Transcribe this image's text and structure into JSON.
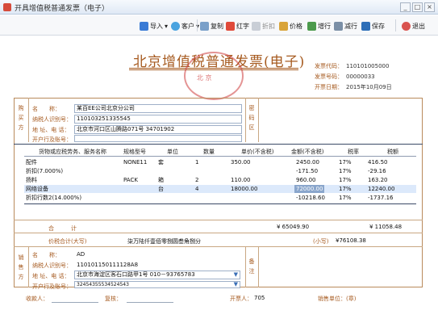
{
  "window": {
    "title": "开具增值税普通发票（电子）",
    "min": "_",
    "max": "□",
    "close": "×"
  },
  "toolbar": {
    "import": "导入",
    "customer": "客户",
    "copy": "复制",
    "red": "红字",
    "discount": "折扣",
    "price": "价格",
    "add_row": "增行",
    "del_row": "减行",
    "save": "保存",
    "exit": "退出"
  },
  "invoice": {
    "title": "北京增值税普通发票(电子)",
    "seal_text": "北 京",
    "code_label": "发票代码：",
    "code": "110101005000",
    "number_label": "发票号码：",
    "number": "00000033",
    "date_label": "开票日期：",
    "date": "2015年10月09日"
  },
  "buyer": {
    "section": "购买方",
    "name_label": "名　　称：",
    "name": "某百EE公司北京分公司",
    "tax_label": "纳税人识别号：",
    "tax_id": "110103251335545",
    "addr_label": "地 址、电 话：",
    "addr": "北京市河口区山腾路071号 34701902",
    "bank_label": "开户行及账号：",
    "bank": ""
  },
  "password_area": "密码区",
  "table": {
    "headers": [
      "货物或应税劳务、服务名称",
      "规格型号",
      "单位",
      "数量",
      "单价(不含税)",
      "金额(不含税)",
      "税率",
      "税额"
    ],
    "rows": [
      [
        "配件",
        "NONE11",
        "套",
        "1",
        "350.00",
        "2450.00",
        "17%",
        "416.50"
      ],
      [
        "折扣(7.000%)",
        "",
        "",
        "",
        "",
        "-171.50",
        "17%",
        "-29.16"
      ],
      [
        "扬料",
        "PACK",
        "箱",
        "2",
        "110.00",
        "960.00",
        "17%",
        "163.20"
      ],
      [
        "网络设备",
        "",
        "台",
        "4",
        "18000.00",
        "72000.00",
        "17%",
        "12240.00"
      ],
      [
        "折扣行数2(14.000%)",
        "",
        "",
        "",
        "",
        "-10218.60",
        "17%",
        "-1737.16"
      ]
    ]
  },
  "totals": {
    "label": "合　　　计",
    "amount": "¥ 65049.90",
    "tax": "¥ 11058.48",
    "words_label": "价税合计(大写)",
    "words": "柒万陆仟壹佰零捌圆叁角捌分",
    "small_label": "(小写)",
    "small": "¥76108.38"
  },
  "seller": {
    "section": "销售方",
    "name_label": "名　　称：",
    "name": "AD",
    "tax_label": "纳税人识别号：",
    "tax_id": "110101150111128A8",
    "addr_label": "地 址、电 话：",
    "addr": "北京市海淀区客石口路甲1号 010－93765783",
    "bank_label": "开户行及账号：",
    "bank": "32454355534524543"
  },
  "remarks": "备注",
  "footer": {
    "payee_label": "收款人：",
    "reviewer_label": "复核：",
    "drawer_label": "开票人：",
    "drawer": "705",
    "seller_label": "销售单位：(章)"
  }
}
